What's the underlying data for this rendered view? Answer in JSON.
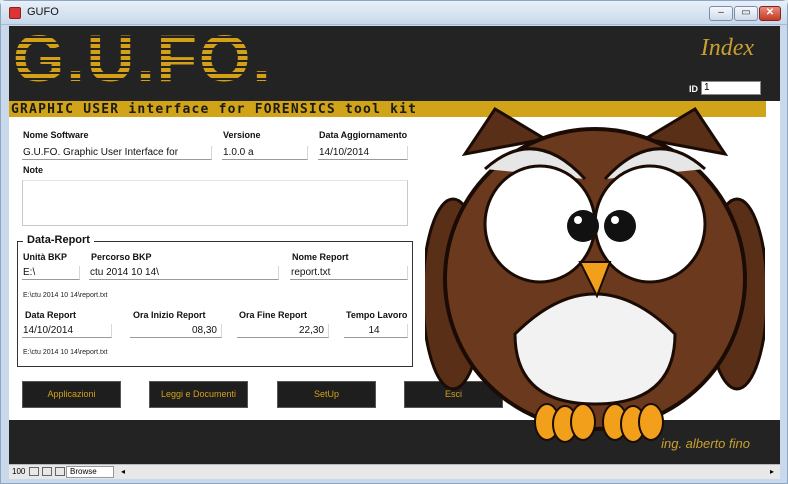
{
  "window": {
    "title": "GUFO",
    "minimize": "‒",
    "maximize": "▭",
    "close": "✕"
  },
  "header": {
    "logo": "G.U.FO.",
    "page_title": "Index",
    "id_label": "ID",
    "id_value": "1"
  },
  "subtitle": "GRAPHIC USER interface for FORENSICS tool kit",
  "software": {
    "name_label": "Nome Software",
    "name_value": "G.U.FO. Graphic User Interface for",
    "version_label": "Versione",
    "version_value": "1.0.0 a",
    "update_label": "Data Aggiornamento",
    "update_value": "14/10/2014",
    "notes_label": "Note"
  },
  "data_report": {
    "title": "Data-Report",
    "unit_label": "Unità BKP",
    "unit_value": "E:\\",
    "path_label": "Percorso BKP",
    "path_value": "ctu 2014 10 14\\",
    "report_name_label": "Nome Report",
    "report_name_value": "report.txt",
    "full_path_1": "E:\\ctu 2014 10 14\\report.txt",
    "date_label": "Data Report",
    "date_value": "14/10/2014",
    "start_label": "Ora Inizio Report",
    "start_value": "08,30",
    "end_label": "Ora Fine Report",
    "end_value": "22,30",
    "work_label": "Tempo Lavoro",
    "work_value": "14",
    "full_path_2": "E:\\ctu 2014 10 14\\report.txt"
  },
  "buttons": [
    "Applicazioni",
    "Leggi e Documenti",
    "SetUp",
    "Esci"
  ],
  "footer": {
    "author": "ing. alberto fino"
  },
  "statusbar": {
    "zoom": "100",
    "mode": "Browse"
  },
  "colors": {
    "gold": "#d4a017",
    "dark": "#232323",
    "owl_brown": "#6b3a1e"
  }
}
